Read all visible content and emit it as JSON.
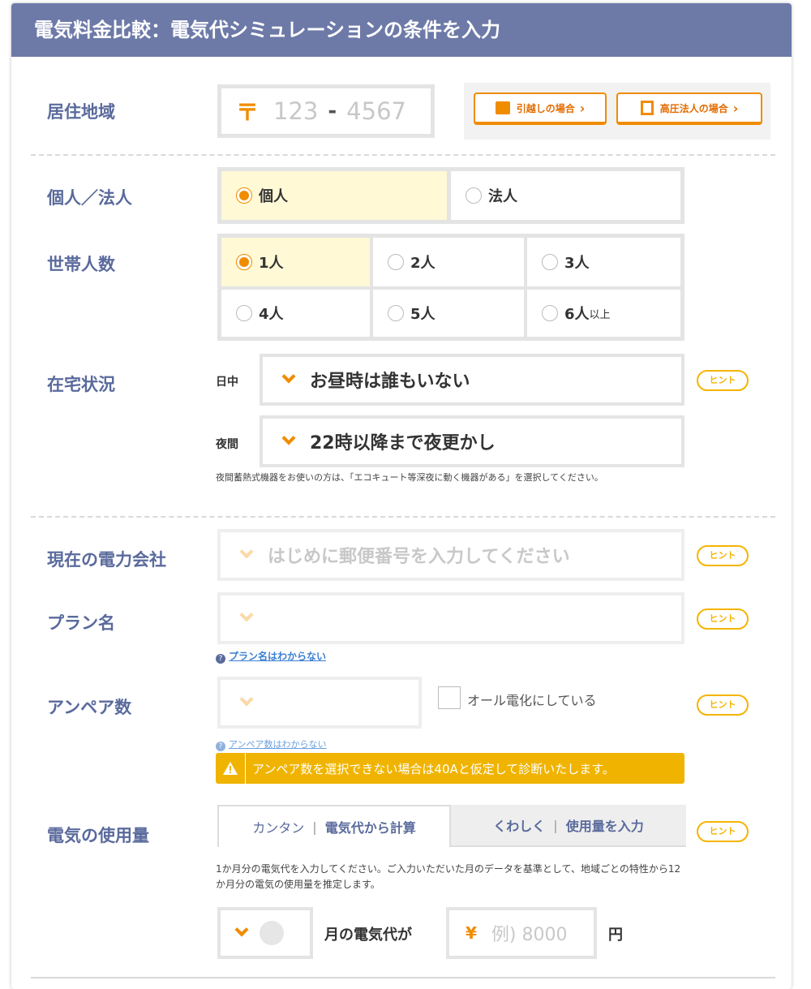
{
  "header": {
    "title": "電気料金比較：電気代シミュレーションの条件を入力"
  },
  "region": {
    "label": "居住地域",
    "postal_mark": "〒",
    "postal_first_placeholder": "123",
    "postal_sep": "-",
    "postal_second_placeholder": "4567",
    "moving_button": "引越しの場合",
    "highvoltage_button": "高圧法人の場合",
    "chevron": "›"
  },
  "entity": {
    "label": "個人／法人",
    "options": [
      "個人",
      "法人"
    ],
    "selected": "個人"
  },
  "household": {
    "label": "世帯人数",
    "options": [
      "1人",
      "2人",
      "3人",
      "4人",
      "5人",
      "6人"
    ],
    "option6_suffix": "以上",
    "selected": "1人"
  },
  "presence": {
    "label": "在宅状況",
    "day_label": "日中",
    "day_value": "お昼時は誰もいない",
    "night_label": "夜間",
    "night_value": "22時以降まで夜更かし",
    "note": "夜間蓄熱式機器をお使いの方は、「エコキュート等深夜に動く機器がある」を選択してください。"
  },
  "provider": {
    "label": "現在の電力会社",
    "placeholder": "はじめに郵便番号を入力してください"
  },
  "plan": {
    "label": "プラン名",
    "unknown_link": "プラン名はわからない"
  },
  "ampere": {
    "label": "アンペア数",
    "all_electric_label": "オール電化にしている",
    "unknown_link": "アンペア数はわからない",
    "warning": "アンペア数を選択できない場合は40Aと仮定して診断いたします。"
  },
  "usage": {
    "label": "電気の使用量",
    "tab_easy_prefix": "カンタン",
    "tab_easy_main": "電気代から計算",
    "tab_detail_prefix": "くわしく",
    "tab_detail_main": "使用量を入力",
    "tab_divider": "|",
    "description": "1か月分の電気代を入力してください。ご入力いただいた月のデータを基準として、地域ごとの特性から12か月分の電気の使用量を推定します。",
    "month_suffix": "月の電気代が",
    "yen_mark": "¥",
    "amount_placeholder": "例) 8000",
    "unit": "円"
  },
  "hint_label": "ヒント",
  "colors": {
    "header_bg": "#6d7aa8",
    "label": "#5a6a9c",
    "accent_orange": "#f08c00",
    "hint_yellow": "#f5b400",
    "selected_bg": "#fff9d6",
    "warning_bg": "#f0b400"
  }
}
